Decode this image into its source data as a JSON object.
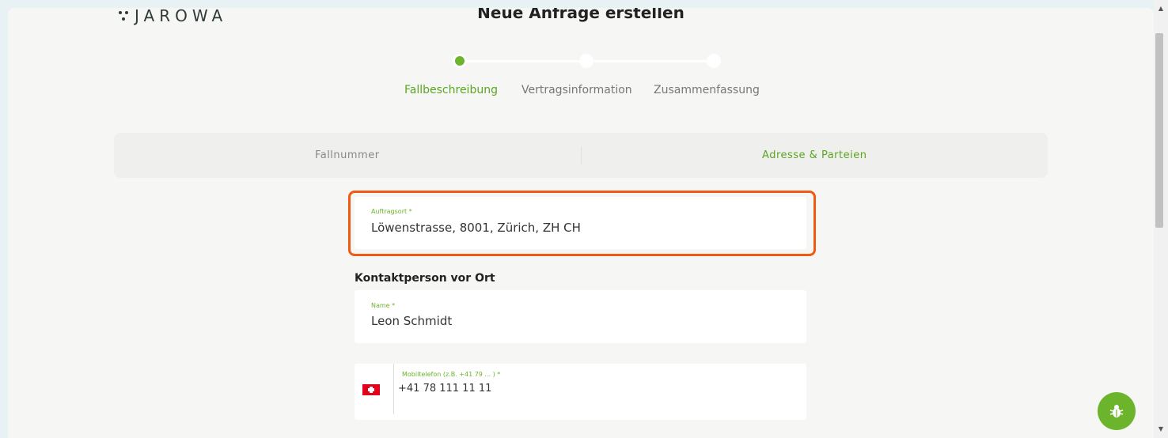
{
  "brand": {
    "logo_text": "JAROWA"
  },
  "page": {
    "title": "Neue Anfrage erstellen"
  },
  "stepper": {
    "steps": [
      {
        "label": "Fallbeschreibung",
        "active": true
      },
      {
        "label": "Vertragsinformation",
        "active": false
      },
      {
        "label": "Zusammenfassung",
        "active": false
      }
    ]
  },
  "tabs": [
    {
      "label": "Fallnummer",
      "active": false
    },
    {
      "label": "Adresse & Parteien",
      "active": true
    }
  ],
  "form": {
    "auftragsort": {
      "label": "Auftragsort *",
      "value": "Löwenstrasse, 8001, Zürich, ZH CH"
    },
    "contact_section_title": "Kontaktperson vor Ort",
    "name": {
      "label": "Name *",
      "value": "Leon Schmidt"
    },
    "mobile": {
      "label": "Mobiltelefon (z.B. +41 79 ... ) *",
      "value": "+41 78 111 11 11",
      "country_flag": "swiss-flag-icon"
    }
  },
  "colors": {
    "accent": "#6cb42c",
    "highlight": "#f05a13",
    "flag_red": "#e4001c"
  },
  "icons": {
    "bug": "bug-icon"
  }
}
